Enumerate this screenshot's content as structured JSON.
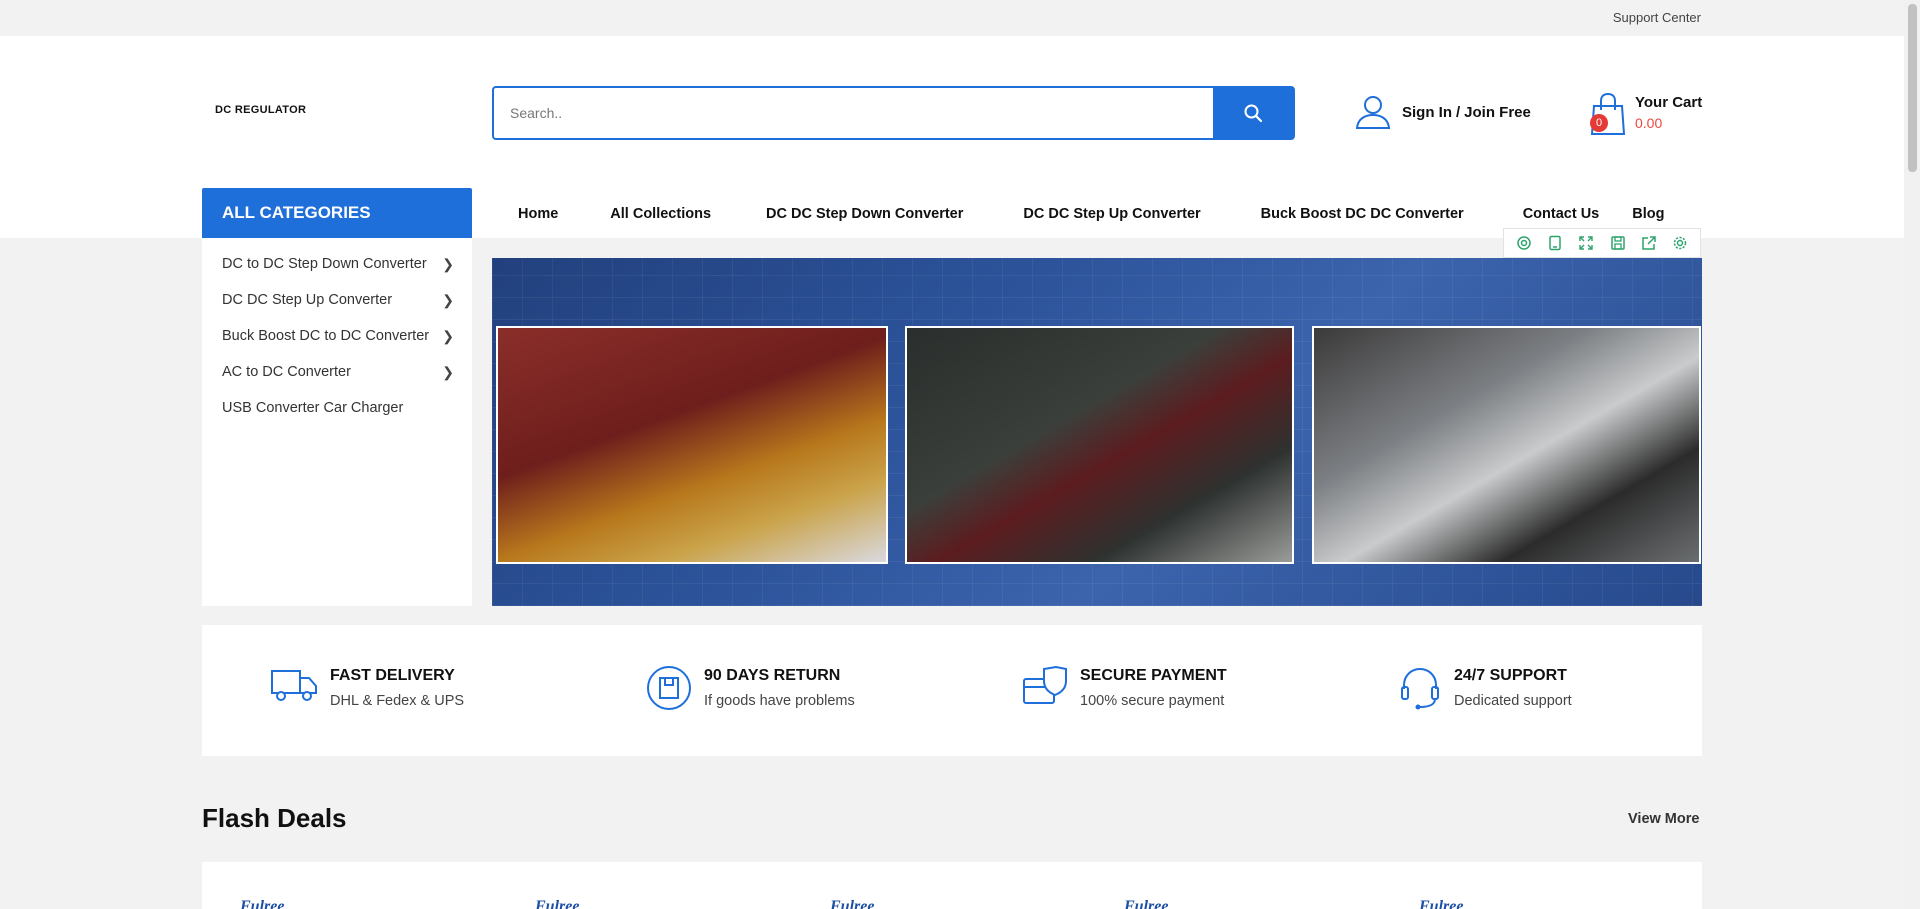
{
  "topbar": {
    "support": "Support Center"
  },
  "header": {
    "logo": "DC REGULATOR",
    "search": {
      "placeholder": "Search.."
    },
    "account": {
      "sign_in": "Sign In",
      "separator": "/",
      "join": "Join Free"
    },
    "cart": {
      "label": "Your Cart",
      "amount": "0.00",
      "count": "0"
    }
  },
  "categories": {
    "title": "ALL CATEGORIES",
    "items": [
      {
        "label": "DC to DC Step Down Converter",
        "has_sub": true
      },
      {
        "label": "DC DC Step Up Converter",
        "has_sub": true
      },
      {
        "label": "Buck Boost DC to DC Converter",
        "has_sub": true
      },
      {
        "label": "AC to DC Converter",
        "has_sub": true
      },
      {
        "label": "USB Converter Car Charger",
        "has_sub": false
      }
    ]
  },
  "nav": {
    "items": [
      "Home",
      "All Collections",
      "DC DC Step Down Converter",
      "DC DC Step Up Converter",
      "Buck Boost DC DC Converter",
      "Contact Us",
      "Blog"
    ]
  },
  "banner_tools": [
    "circle-icon",
    "tablet-icon",
    "expand-icon",
    "save-icon",
    "share-icon",
    "gear-icon"
  ],
  "features": [
    {
      "title": "FAST DELIVERY",
      "sub": "DHL & Fedex & UPS",
      "icon": "truck-icon"
    },
    {
      "title": "90 DAYS RETURN",
      "sub": "If goods have problems",
      "icon": "return-box-icon"
    },
    {
      "title": "SECURE PAYMENT",
      "sub": "100% secure payment",
      "icon": "secure-card-icon"
    },
    {
      "title": "24/7 SUPPORT",
      "sub": "Dedicated support",
      "icon": "headset-icon"
    }
  ],
  "flash": {
    "title": "Flash Deals",
    "view_more": "View More",
    "brands": [
      "Fulree",
      "Fulree",
      "Fulree",
      "Fulree",
      "Fulree"
    ]
  },
  "colors": {
    "accent": "#1e6fd9",
    "price": "#e8493f",
    "badge": "#e53935",
    "tool": "#2fa36b"
  }
}
